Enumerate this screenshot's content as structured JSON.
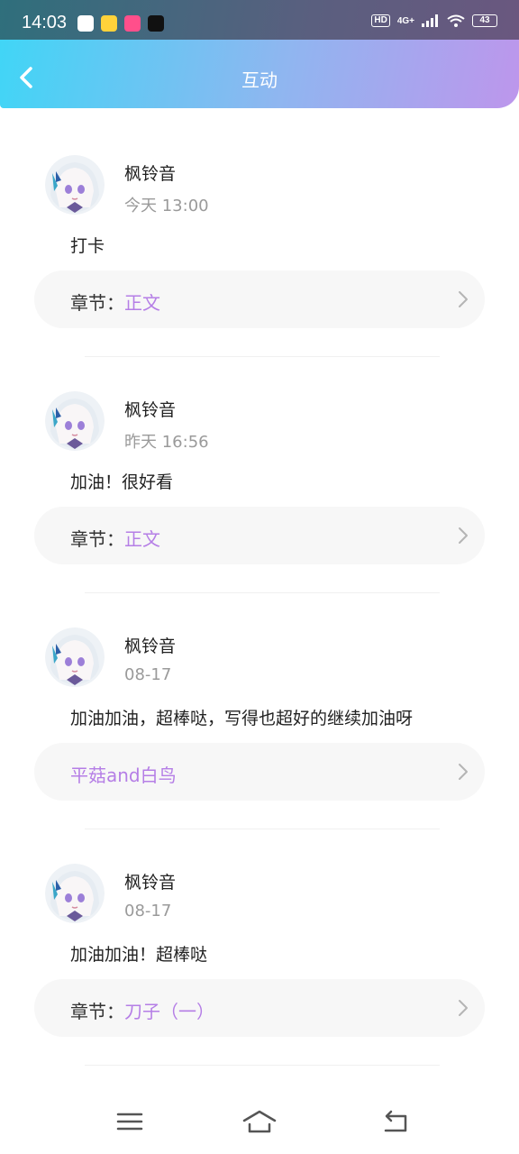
{
  "status_bar": {
    "time": "14:03",
    "hd_label": "HD",
    "network_label": "4G+",
    "battery_level": "43"
  },
  "header": {
    "title": "互动"
  },
  "chapter_prefix": "章节：",
  "posts": [
    {
      "user": "枫铃音",
      "time": "今天 13:00",
      "comment": "打卡",
      "chapter": "正文"
    },
    {
      "user": "枫铃音",
      "time": "昨天 16:56",
      "comment": "加油！很好看",
      "chapter": "正文"
    },
    {
      "user": "枫铃音",
      "time": "08-17",
      "comment": "加油加油，超棒哒，写得也超好的继续加油呀",
      "work_title": "平菇and白鸟"
    },
    {
      "user": "枫铃音",
      "time": "08-17",
      "comment": "加油加油！超棒哒",
      "chapter": "刀子（一）"
    }
  ],
  "colors": {
    "accent": "#b57ee6",
    "header_start": "#3fd6f6",
    "header_end": "#bd96ec"
  }
}
